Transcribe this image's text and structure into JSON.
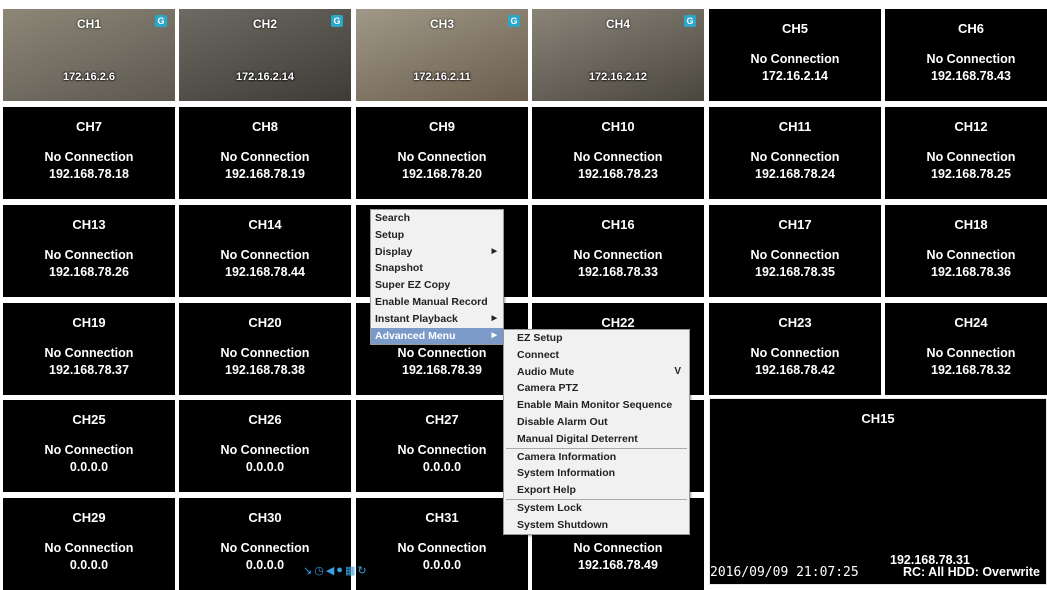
{
  "camera_views": [
    {
      "channel": "CH1",
      "ip": "172.16.2.6",
      "badge": "G"
    },
    {
      "channel": "CH2",
      "ip": "172.16.2.14",
      "badge": "G"
    },
    {
      "channel": "CH3",
      "ip": "172.16.2.11",
      "badge": "G"
    },
    {
      "channel": "CH4",
      "ip": "172.16.2.12",
      "badge": "G"
    }
  ],
  "cells": [
    {
      "channel": "CH5",
      "status": "No Connection",
      "ip": "172.16.2.14"
    },
    {
      "channel": "CH6",
      "status": "No Connection",
      "ip": "192.168.78.43"
    },
    {
      "channel": "CH7",
      "status": "No Connection",
      "ip": "192.168.78.18"
    },
    {
      "channel": "CH8",
      "status": "No Connection",
      "ip": "192.168.78.19"
    },
    {
      "channel": "CH9",
      "status": "No Connection",
      "ip": "192.168.78.20"
    },
    {
      "channel": "CH10",
      "status": "No Connection",
      "ip": "192.168.78.23"
    },
    {
      "channel": "CH11",
      "status": "No Connection",
      "ip": "192.168.78.24"
    },
    {
      "channel": "CH12",
      "status": "No Connection",
      "ip": "192.168.78.25"
    },
    {
      "channel": "CH13",
      "status": "No Connection",
      "ip": "192.168.78.26"
    },
    {
      "channel": "CH14",
      "status": "No Connection",
      "ip": "192.168.78.44"
    },
    {
      "channel": "",
      "status": "",
      "ip": ""
    },
    {
      "channel": "CH16",
      "status": "No Connection",
      "ip": "192.168.78.33"
    },
    {
      "channel": "CH17",
      "status": "No Connection",
      "ip": "192.168.78.35"
    },
    {
      "channel": "CH18",
      "status": "No Connection",
      "ip": "192.168.78.36"
    },
    {
      "channel": "CH19",
      "status": "No Connection",
      "ip": "192.168.78.37"
    },
    {
      "channel": "CH20",
      "status": "No Connection",
      "ip": "192.168.78.38"
    },
    {
      "channel": "",
      "status": "No Connection",
      "ip": "192.168.78.39"
    },
    {
      "channel": "CH22",
      "status": "",
      "ip": ""
    },
    {
      "channel": "CH23",
      "status": "No Connection",
      "ip": "192.168.78.42"
    },
    {
      "channel": "CH24",
      "status": "No Connection",
      "ip": "192.168.78.32"
    },
    {
      "channel": "CH25",
      "status": "No Connection",
      "ip": "0.0.0.0"
    },
    {
      "channel": "CH26",
      "status": "No Connection",
      "ip": "0.0.0.0"
    },
    {
      "channel": "CH27",
      "status": "No Connection",
      "ip": "0.0.0.0"
    },
    {
      "channel": "",
      "status": "",
      "ip": ""
    },
    {
      "channel": "CH29",
      "status": "No Connection",
      "ip": "0.0.0.0"
    },
    {
      "channel": "CH30",
      "status": "No Connection",
      "ip": "0.0.0.0"
    },
    {
      "channel": "CH31",
      "status": "No Connection",
      "ip": "0.0.0.0"
    },
    {
      "channel": "",
      "status": "No Connection",
      "ip": "192.168.78.49"
    }
  ],
  "big_view": {
    "channel": "CH15",
    "ip": "192.168.78.31",
    "datetime": "2016/09/09 21:07:25",
    "rc_hdd": "RC: All  HDD: Overwrite"
  },
  "context_menu": {
    "items": [
      {
        "label": "Search"
      },
      {
        "label": "Setup"
      },
      {
        "label": "Display",
        "submenu": true
      },
      {
        "label": "Snapshot"
      },
      {
        "label": "Super EZ Copy"
      },
      {
        "label": "Enable Manual Record"
      },
      {
        "label": "Instant Playback",
        "submenu": true
      },
      {
        "label": "Advanced Menu",
        "submenu": true,
        "active": true
      }
    ]
  },
  "submenu": {
    "groups": [
      [
        {
          "label": "EZ Setup"
        },
        {
          "label": "Connect"
        },
        {
          "label": "Audio Mute",
          "suffix": "V"
        },
        {
          "label": "Camera PTZ"
        },
        {
          "label": "Enable Main Monitor Sequence"
        },
        {
          "label": "Disable Alarm Out"
        },
        {
          "label": "Manual Digital Deterrent"
        }
      ],
      [
        {
          "label": "Camera Information"
        },
        {
          "label": "System Information"
        },
        {
          "label": "Export Help"
        }
      ],
      [
        {
          "label": "System Lock"
        },
        {
          "label": "System Shutdown"
        }
      ]
    ]
  },
  "status_icons": [
    "network-icon",
    "clock-icon",
    "audio-icon",
    "record-icon",
    "hdd-icon",
    "refresh-icon"
  ],
  "colors": {
    "cell_bg": "#000000",
    "menu_bg": "#f1f1f1",
    "menu_active": "#7b9ac8",
    "badge": "#2aa7c9"
  }
}
